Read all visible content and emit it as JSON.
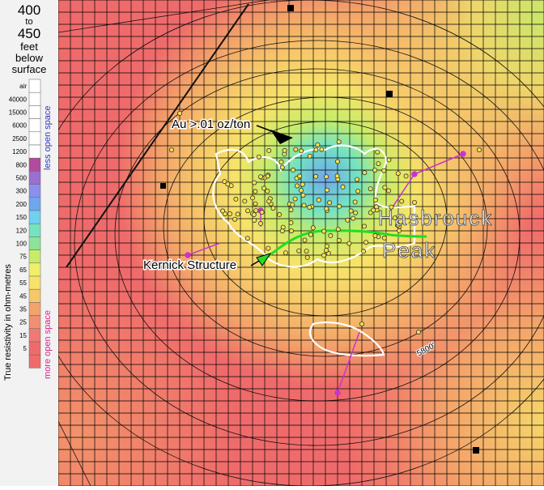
{
  "depth": {
    "from": "400",
    "to": "to",
    "to_value": "450",
    "unit1": "feet",
    "unit2": "below",
    "unit3": "surface"
  },
  "legend": {
    "axis_title": "True resistivity in ohm-metres",
    "top_label": "less open space",
    "bottom_label": "more open space",
    "top_label_color": "#3333cc",
    "bottom_label_color": "#e0208f",
    "entries": [
      {
        "label": "air",
        "color": "#ffffff"
      },
      {
        "label": "40000",
        "color": "#ffffff"
      },
      {
        "label": "15000",
        "color": "#ffffff"
      },
      {
        "label": "6000",
        "color": "#ffffff"
      },
      {
        "label": "2500",
        "color": "#ffffff"
      },
      {
        "label": "1200",
        "color": "#ffffff"
      },
      {
        "label": "800",
        "color": "#b24a9e"
      },
      {
        "label": "500",
        "color": "#9b6fcf"
      },
      {
        "label": "300",
        "color": "#8a8ff0"
      },
      {
        "label": "200",
        "color": "#6fa6ee"
      },
      {
        "label": "150",
        "color": "#6fd0f0"
      },
      {
        "label": "120",
        "color": "#73e3c2"
      },
      {
        "label": "100",
        "color": "#8de39a"
      },
      {
        "label": "75",
        "color": "#c7ec6a"
      },
      {
        "label": "65",
        "color": "#eef06a"
      },
      {
        "label": "55",
        "color": "#f7e36a"
      },
      {
        "label": "45",
        "color": "#f6c86a"
      },
      {
        "label": "35",
        "color": "#f3a46a"
      },
      {
        "label": "25",
        "color": "#f08f72"
      },
      {
        "label": "15",
        "color": "#ee7a76"
      },
      {
        "label": "5",
        "color": "#ef6b6b"
      },
      {
        "label": "",
        "color": "#ef6b6b"
      }
    ]
  },
  "map": {
    "annotations": {
      "gold": "Au >.01 oz/ton",
      "structure": "Kernick Structure",
      "contour": "5800'",
      "peak_line1": "Hasbrouck",
      "peak_line2": "Peak"
    },
    "colors": {
      "background": "#ef6b6b",
      "grid": "#000000",
      "gold_outline": "#ffffff",
      "structure": "#22dd22",
      "sample": "#f5e24a",
      "drillhole": "#cc33cc"
    }
  }
}
